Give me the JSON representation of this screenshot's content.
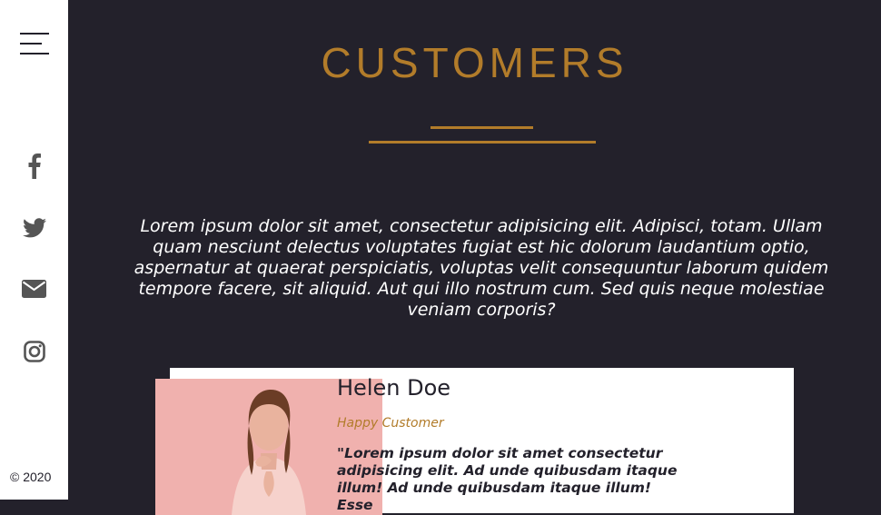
{
  "sidebar": {
    "social": [
      {
        "icon": "facebook-icon"
      },
      {
        "icon": "twitter-icon"
      },
      {
        "icon": "envelope-icon"
      },
      {
        "icon": "instagram-icon"
      }
    ],
    "copyright": "© 2020"
  },
  "section": {
    "title": "CUSTOMERS",
    "intro": "Lorem ipsum dolor sit amet, consectetur adipisicing elit. Adipisci, totam. Ullam quam nesciunt delectus voluptates fugiat est hic dolorum laudantium optio, aspernatur at quaerat perspiciatis, voluptas velit consequuntur laborum quidem tempore facere, sit aliquid. Aut qui illo nostrum cum. Sed quis neque molestiae veniam corporis?"
  },
  "testimonial": {
    "name": "Helen Doe",
    "role": "Happy Customer",
    "quote": "\"Lorem ipsum dolor sit amet consectetur adipisicing elit. Ad unde quibusdam itaque illum! Ad unde quibusdam itaque illum! Esse"
  },
  "colors": {
    "accent": "#b27c2a",
    "background": "#23212b",
    "sidebar": "#ffffff"
  }
}
